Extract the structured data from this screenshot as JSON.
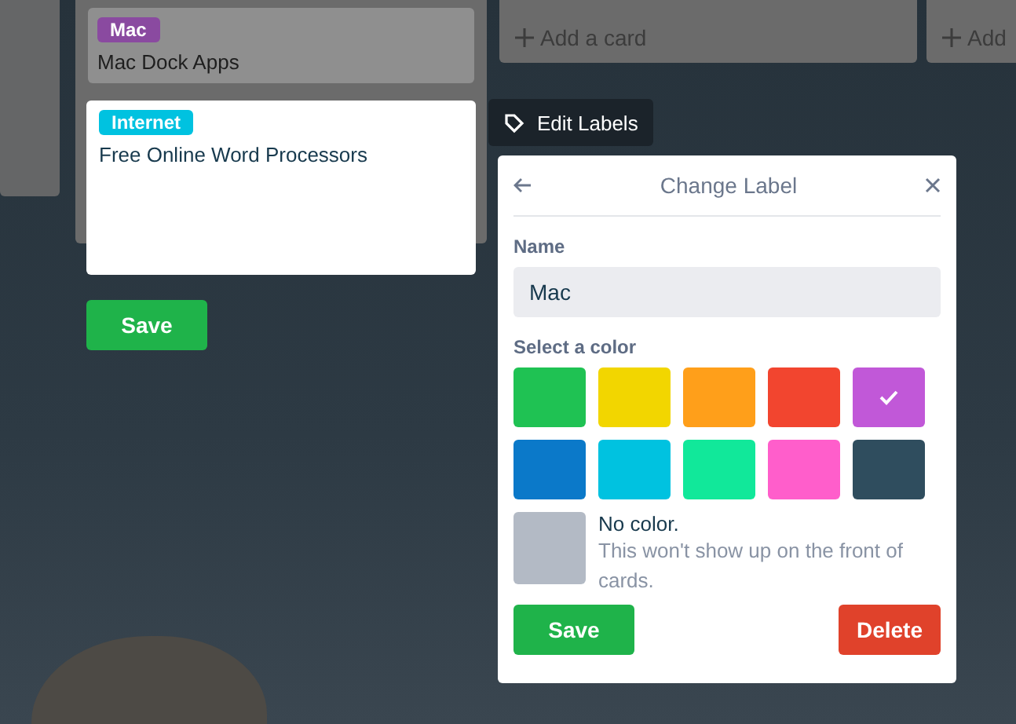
{
  "board": {
    "lists": [
      {
        "cards": [
          {
            "label": {
              "text": "Mac",
              "color": "#8a4aa0"
            },
            "title": "Mac Dock Apps"
          }
        ]
      },
      {
        "add_card": "Add a card"
      },
      {
        "add_card": "Add"
      }
    ]
  },
  "edit_card": {
    "label": {
      "text": "Internet",
      "color": "#00c2e0"
    },
    "title": "Free Online Word Processors",
    "save": "Save"
  },
  "edit_labels_button": "Edit Labels",
  "popover": {
    "title": "Change Label",
    "name_label": "Name",
    "name_value": "Mac",
    "color_label": "Select a color",
    "colors": [
      {
        "color": "#1fc253",
        "selected": false
      },
      {
        "color": "#f2d600",
        "selected": false
      },
      {
        "color": "#ff9f1a",
        "selected": false
      },
      {
        "color": "#f2452f",
        "selected": false
      },
      {
        "color": "#c158d8",
        "selected": true
      },
      {
        "color": "#0b79c9",
        "selected": false
      },
      {
        "color": "#00c2e0",
        "selected": false
      },
      {
        "color": "#11e89a",
        "selected": false
      },
      {
        "color": "#ff5ecb",
        "selected": false
      },
      {
        "color": "#2f4d5e",
        "selected": false
      }
    ],
    "no_color": {
      "title": "No color.",
      "text": "This won't show up on the front of cards.",
      "selected": false
    },
    "save": "Save",
    "delete": "Delete"
  }
}
